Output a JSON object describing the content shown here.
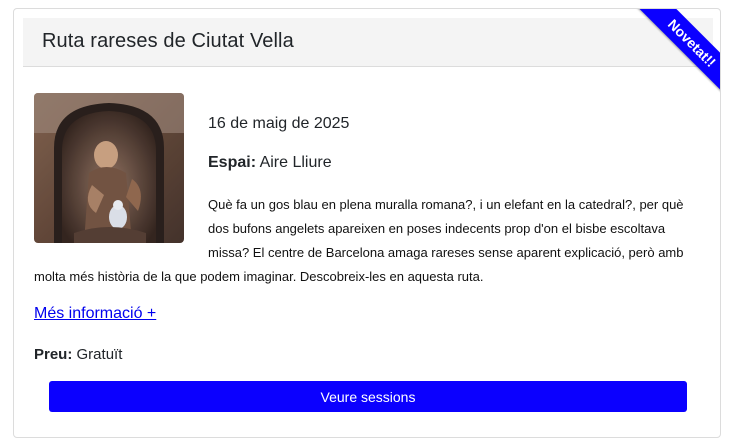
{
  "card": {
    "title": "Ruta rareses de Ciutat Vella",
    "ribbon": "Novetat!!",
    "date": "16 de maig de 2025",
    "space_label": "Espai:",
    "space_value": "Aire Lliure",
    "description": "Què fa un gos blau en plena muralla romana?, i un elefant en la catedral?, per què dos bufons angelets apareixen en poses indecents prop d'on el bisbe escoltava missa? El centre de Barcelona amaga rareses sense aparent explicació, però amb molta més història de la que podem imaginar. Descobreix-les en aquesta ruta.",
    "more_link": "Més informació +",
    "price_label": "Preu:",
    "price_value": "Gratuït",
    "sessions_button": "Veure sessions"
  },
  "colors": {
    "accent": "#0b00ff",
    "link": "#0000ee",
    "header_bg": "#f4f4f4"
  }
}
